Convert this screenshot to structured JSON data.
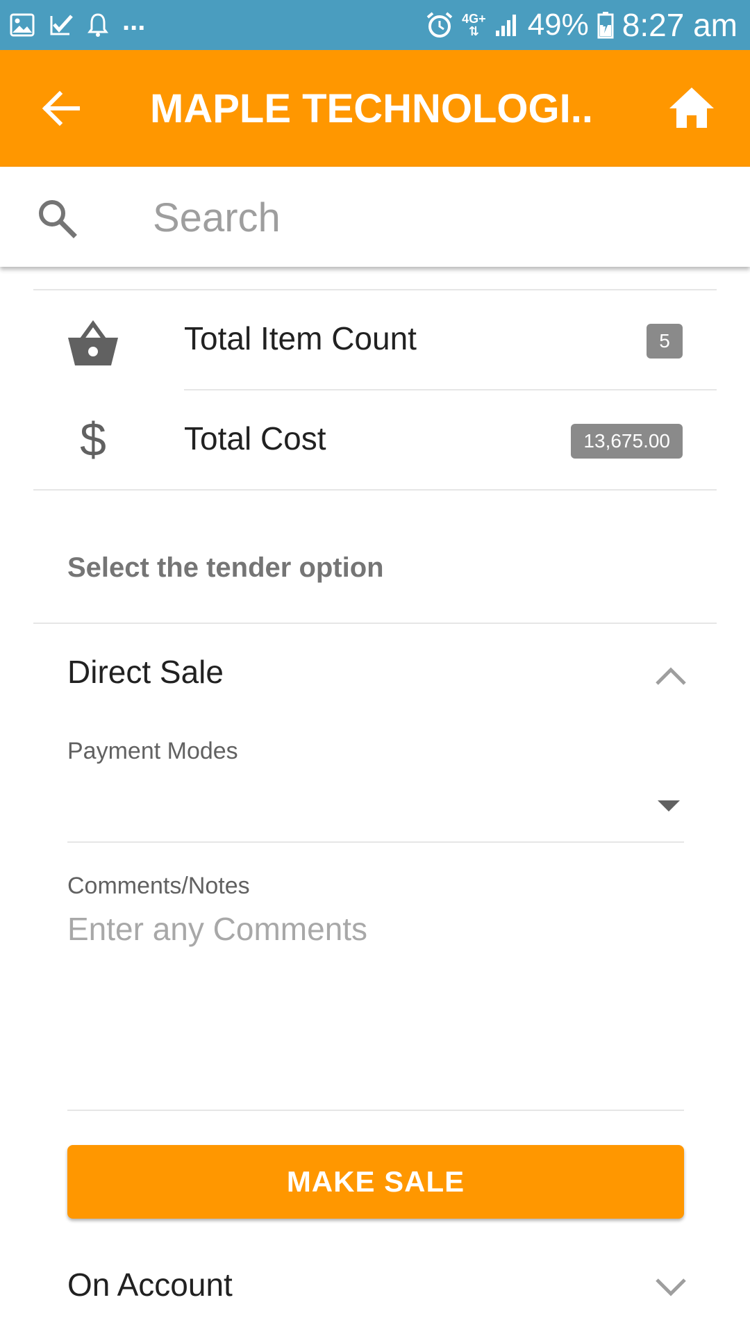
{
  "status_bar": {
    "network": "4G+",
    "battery": "49%",
    "time": "8:27 am",
    "overflow": "...",
    "icons": [
      "gallery-icon",
      "check-icon",
      "bell-icon",
      "alarm-icon",
      "signal-icon",
      "battery-icon"
    ]
  },
  "app_bar": {
    "title": "MAPLE TECHNOLOGI...",
    "back_icon": "arrow-left-icon",
    "home_icon": "home-icon",
    "background": "#ff9700"
  },
  "search": {
    "placeholder": "Search",
    "value": ""
  },
  "summary": {
    "item_count_label": "Total Item Count",
    "item_count_value": "5",
    "total_cost_label": "Total Cost",
    "total_cost_value": "13,675.00"
  },
  "tender": {
    "heading": "Select the tender option",
    "direct_sale": {
      "title": "Direct Sale",
      "payment_modes_label": "Payment Modes",
      "payment_modes_value": "",
      "comments_label": "Comments/Notes",
      "comments_placeholder": "Enter any Comments",
      "make_sale_label": "MAKE SALE"
    },
    "on_account": {
      "title": "On Account"
    }
  },
  "colors": {
    "accent": "#ff9700",
    "status_bar": "#4a9dbf",
    "badge": "#8a8a8a"
  }
}
